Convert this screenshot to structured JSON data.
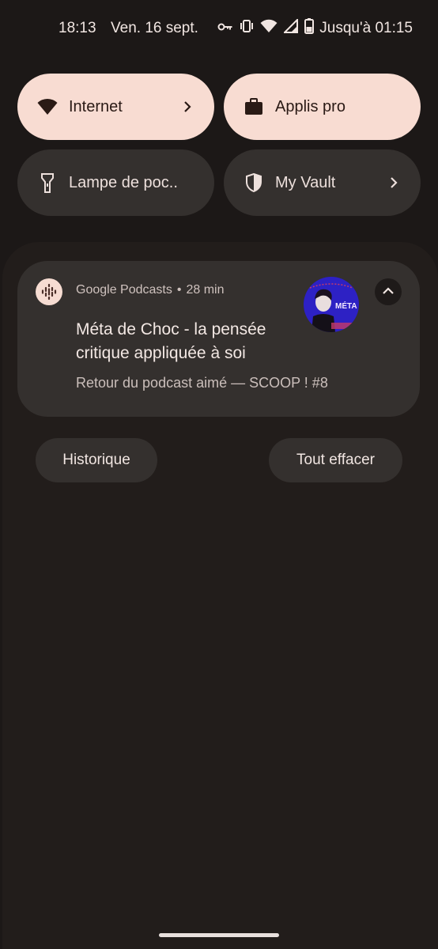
{
  "status_bar": {
    "time": "18:13",
    "date": "Ven. 16 sept.",
    "battery_text": "Jusqu'à 01:15",
    "icons": [
      "vpn-key-icon",
      "vibrate-icon",
      "wifi-icon",
      "cell-signal-icon",
      "battery-icon"
    ]
  },
  "quick_settings": {
    "tiles": [
      {
        "label": "Internet",
        "icon": "wifi-icon",
        "state": "active",
        "has_chevron": true
      },
      {
        "label": "Applis pro",
        "icon": "briefcase-icon",
        "state": "active",
        "has_chevron": false
      },
      {
        "label": "Lampe de poc..",
        "icon": "flashlight-icon",
        "state": "inactive",
        "has_chevron": false
      },
      {
        "label": "My Vault",
        "icon": "shield-icon",
        "state": "inactive",
        "has_chevron": true
      }
    ]
  },
  "notification": {
    "app_name": "Google Podcasts",
    "separator": "•",
    "time_ago": "28 min",
    "title": "Méta de Choc - la pensée critique appliquée à soi",
    "text": "Retour du podcast aimé — SCOOP ! #8",
    "artwork_text": "MÉTA"
  },
  "actions": {
    "history_label": "Historique",
    "clear_all_label": "Tout effacer"
  },
  "colors": {
    "background": "#1c1817",
    "tile_active": "#f8dcd2",
    "tile_inactive": "#34302e",
    "card": "#34302e"
  }
}
